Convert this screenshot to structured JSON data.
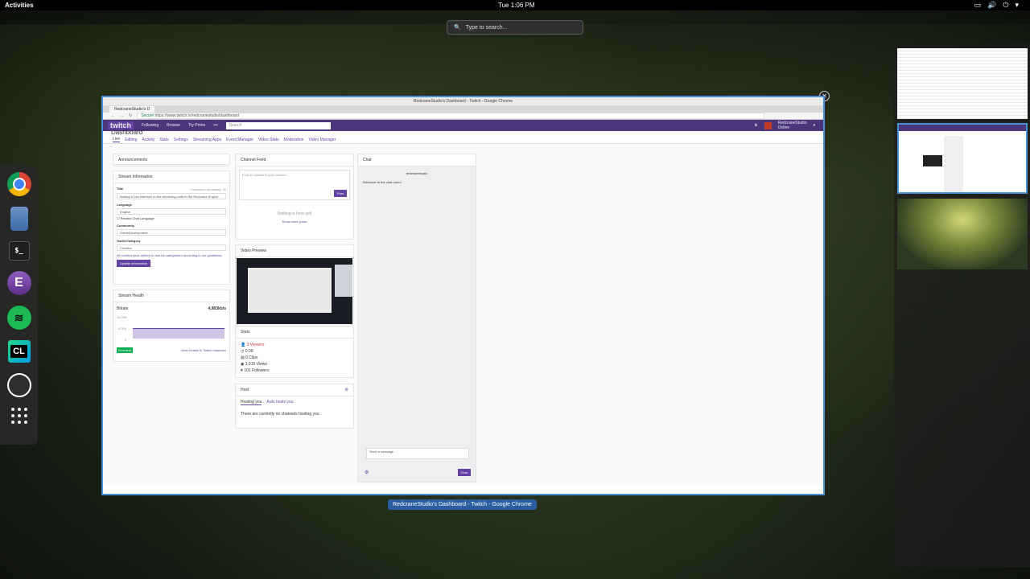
{
  "topbar": {
    "activities": "Activities",
    "clock": "Tue  1:06 PM"
  },
  "search": {
    "placeholder": "Type to search..."
  },
  "window": {
    "title": "RedcraneStudio's Dashboard - Twitch - Google Chrome",
    "tab_label": "RedcraneStudio's D",
    "secure_label": "Secure",
    "url": "https://www.twitch.tv/redcranestudio/dashboard",
    "caption": "RedcraneStudio's Dashboard - Twitch - Google Chrome"
  },
  "twitch": {
    "logo": "twitch",
    "nav": [
      "Following",
      "Browse",
      "Try Prime",
      "•••"
    ],
    "search_placeholder": "Search",
    "user_name": "RedcraneStudio",
    "user_status": "Online",
    "dashboard_title": "Dashboard",
    "subnav": [
      "Live",
      "Editing",
      "Activity",
      "Stats",
      "Settings",
      "Streaming Apps",
      "Event Manager",
      "Video Stats",
      "Moderation",
      "Video Manager"
    ]
  },
  "announcements": {
    "title": "Announcements"
  },
  "stream_info": {
    "title": "Stream Information",
    "title_label": "Title",
    "chars_remaining": "Characters remaining: 32",
    "title_value": "Adding a Lua interface to live rendering code in the Redcrane Engine",
    "language_label": "Language",
    "language_value": "English",
    "restrict_label": "Restrict Chat Language",
    "community_label": "Community",
    "community_value": "GameDevelopment",
    "game_label": "Game/Category",
    "game_value": "Creative",
    "guidelines": "All content must adhere to and be categorized according to our  guidelines",
    "update_button": "Update Information"
  },
  "stream_health": {
    "title": "Stream Health",
    "bitrate_label": "Bitrate",
    "bitrate_value": "4,983kb/s",
    "y_ticks": [
      "10,000",
      "5,000",
      "0"
    ],
    "status": "Excellent",
    "inspector_link": "View Details in Twitch Inspector"
  },
  "channel_feed": {
    "title": "Channel Feed",
    "placeholder": "Post an update to your channel...",
    "post_button": "Post",
    "empty": "Nothing is here yet!",
    "more": "Show more posts"
  },
  "video_preview": {
    "title": "Video Preview"
  },
  "stats": {
    "title": "Stats",
    "items": [
      "3 Viewers",
      "0:09",
      "0 Clips",
      "1,015 Views",
      "101 Followers"
    ]
  },
  "host": {
    "title": "Host",
    "tabs": [
      "Hosting you",
      "Auto hosts you"
    ],
    "empty": "There are currently no channels hosting you"
  },
  "chat": {
    "title": "Chat",
    "channel": "redcranestudio",
    "welcome": "Welcome to the chat room!",
    "placeholder": "Send a message",
    "button": "Chat"
  },
  "colors": {
    "accent": "#6441a4",
    "nav": "#4b367c",
    "highlight": "#4a90d9"
  }
}
